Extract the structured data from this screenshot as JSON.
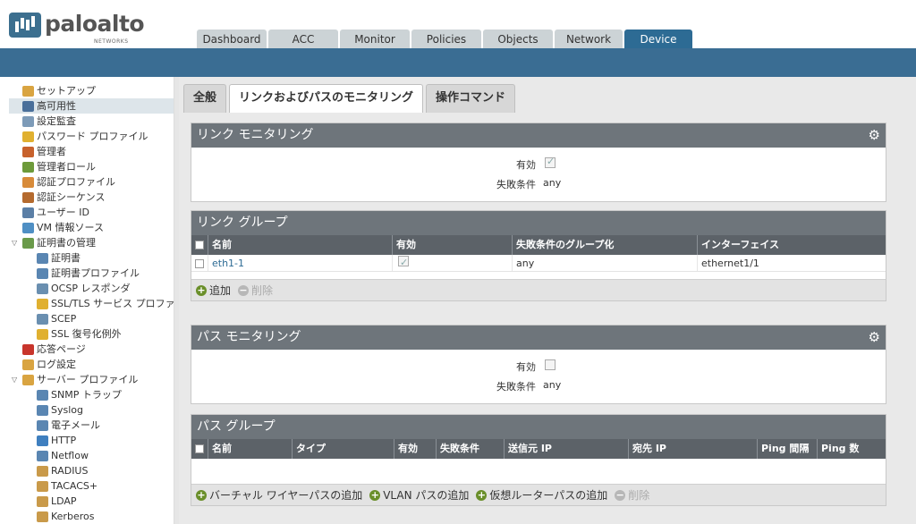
{
  "brand": {
    "name": "paloalto",
    "sub": "NETWORKS"
  },
  "nav_tabs": [
    "Dashboard",
    "ACC",
    "Monitor",
    "Policies",
    "Objects",
    "Network",
    "Device"
  ],
  "sidebar": {
    "items": [
      "セットアップ",
      "高可用性",
      "設定監査",
      "パスワード プロファイル",
      "管理者",
      "管理者ロール",
      "認証プロファイル",
      "認証シーケンス",
      "ユーザー ID",
      "VM 情報ソース",
      "証明書の管理",
      "証明書",
      "証明書プロファイル",
      "OCSP レスポンダ",
      "SSL/TLS サービス プロファイル",
      "SCEP",
      "SSL 復号化例外",
      "応答ページ",
      "ログ設定",
      "サーバー プロファイル",
      "SNMP トラップ",
      "Syslog",
      "電子メール",
      "HTTP",
      "Netflow",
      "RADIUS",
      "TACACS+",
      "LDAP",
      "Kerberos"
    ]
  },
  "subtabs": [
    "全般",
    "リンクおよびパスのモニタリング",
    "操作コマンド"
  ],
  "link_monitoring": {
    "title": "リンク モニタリング",
    "enabled_label": "有効",
    "failure_label": "失敗条件",
    "failure_value": "any"
  },
  "link_group": {
    "title": "リンク グループ",
    "columns": [
      "名前",
      "有効",
      "失敗条件のグループ化",
      "インターフェイス"
    ],
    "rows": [
      {
        "name": "eth1-1",
        "group": "any",
        "iface": "ethernet1/1"
      }
    ],
    "add_label": "追加",
    "delete_label": "削除"
  },
  "path_monitoring": {
    "title": "パス モニタリング",
    "enabled_label": "有効",
    "failure_label": "失敗条件",
    "failure_value": "any"
  },
  "path_group": {
    "title": "パス グループ",
    "columns": [
      "名前",
      "タイプ",
      "有効",
      "失敗条件",
      "送信元 IP",
      "宛先 IP",
      "Ping 間隔",
      "Ping 数"
    ],
    "add_vwire": "バーチャル ワイヤーパスの追加",
    "add_vlan": "VLAN パスの追加",
    "add_vrouter": "仮想ルーターパスの追加",
    "delete_label": "削除"
  },
  "colors": {
    "accent": "#2d6b94",
    "panel_header": "#6e757b",
    "band": "#3a6d93"
  }
}
